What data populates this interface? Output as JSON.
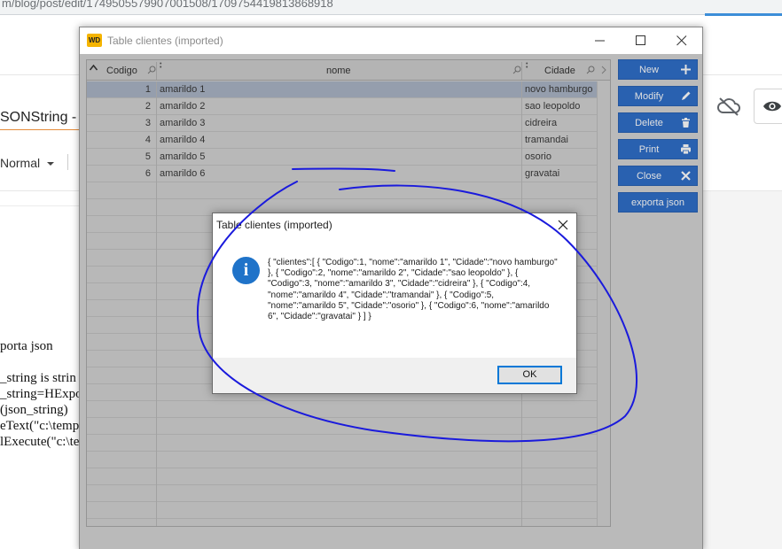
{
  "browser": {
    "url": "m/blog/post/edit/1749505579907001508/1709754419813868918"
  },
  "editor": {
    "title_fragment": "SONString -",
    "format_select": "Normal",
    "code_lines": [
      "porta json",
      "_string is strin",
      "_string=HExpo",
      "(json_string)",
      "eText(\"c:\\temp",
      "lExecute(\"c:\\te"
    ]
  },
  "window": {
    "title": "Table clientes (imported)",
    "logo": "WD"
  },
  "grid": {
    "columns": [
      "Codigo",
      "nome",
      "Cidade"
    ],
    "rows": [
      {
        "codigo": "1",
        "nome": "amarildo 1",
        "cidade": "novo hamburgo"
      },
      {
        "codigo": "2",
        "nome": "amarildo 2",
        "cidade": "sao leopoldo"
      },
      {
        "codigo": "3",
        "nome": "amarildo 3",
        "cidade": "cidreira"
      },
      {
        "codigo": "4",
        "nome": "amarildo 4",
        "cidade": "tramandai"
      },
      {
        "codigo": "5",
        "nome": "amarildo 5",
        "cidade": "osorio"
      },
      {
        "codigo": "6",
        "nome": "amarildo 6",
        "cidade": "gravatai"
      }
    ],
    "selected_row": 0
  },
  "buttons": {
    "new": "New",
    "modify": "Modify",
    "delete": "Delete",
    "print": "Print",
    "close": "Close",
    "export_json": "exporta json"
  },
  "dialog": {
    "title": "Table clientes (imported)",
    "message": "{ \"clientes\":[ { \"Codigo\":1, \"nome\":\"amarildo 1\", \"Cidade\":\"novo hamburgo\" }, { \"Codigo\":2, \"nome\":\"amarildo 2\", \"Cidade\":\"sao leopoldo\" }, { \"Codigo\":3, \"nome\":\"amarildo 3\", \"Cidade\":\"cidreira\" }, { \"Codigo\":4, \"nome\":\"amarildo 4\", \"Cidade\":\"tramandai\" }, { \"Codigo\":5, \"nome\":\"amarildo 5\", \"Cidade\":\"osorio\" }, { \"Codigo\":6, \"nome\":\"amarildo 6\", \"Cidade\":\"gravatai\" } ] }",
    "ok_label": "OK",
    "icon": "info-icon"
  },
  "colors": {
    "button_blue": "#2f6fc9",
    "selected_row": "#aab4c5",
    "annotation_ink": "#1a1adc",
    "info_blue": "#1f73c9"
  }
}
